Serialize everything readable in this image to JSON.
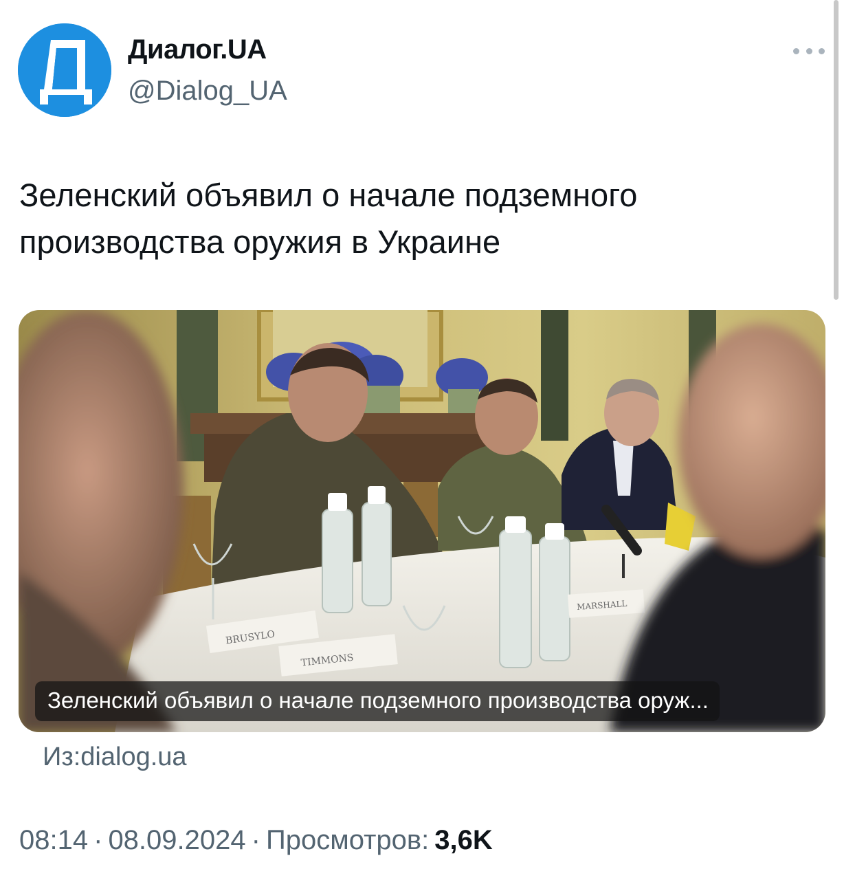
{
  "author": {
    "avatar_letter": "Д",
    "avatar_color": "#1d8fe0",
    "display_name": "Диалог.UA",
    "handle": "@Dialog_UA"
  },
  "tweet": {
    "text": "Зеленский объявил о начале подземного производства оружия в Украине"
  },
  "card": {
    "caption": "Зеленский объявил о начале подземного производства оруж...",
    "source": "Из:dialog.ua",
    "nameplates": [
      "BRUSYLO",
      "TIMMONS",
      "MARSHALL"
    ]
  },
  "meta": {
    "time": "08:14",
    "date": "08.09.2024",
    "views_label": "Просмотров:",
    "views_count": "3,6K",
    "separator": "·"
  },
  "icons": {
    "more": "more-horizontal-icon"
  }
}
